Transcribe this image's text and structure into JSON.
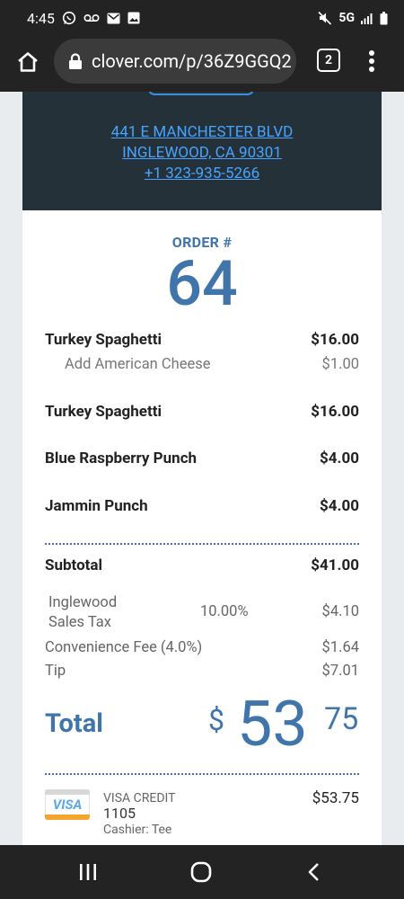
{
  "status_bar": {
    "time": "4:45",
    "network": "5G",
    "icons": [
      "whatsapp-icon",
      "voicemail-icon",
      "mail-icon",
      "image-icon",
      "mute-icon",
      "signal-icon",
      "battery-icon"
    ]
  },
  "browser": {
    "url": "clover.com/p/36Z9GGQ2",
    "tab_count": "2",
    "icons": [
      "home-icon",
      "lock-icon",
      "more-vert-icon"
    ]
  },
  "merchant": {
    "address_line1": "441 E MANCHESTER BLVD",
    "address_line2": "INGLEWOOD, CA 90301",
    "phone": "+1 323-935-5266"
  },
  "order": {
    "label": "ORDER #",
    "number": "64"
  },
  "items": [
    {
      "name": "Turkey Spaghetti",
      "price": "$16.00",
      "modifier": {
        "name": "Add American Cheese",
        "price": "$1.00"
      }
    },
    {
      "name": "Turkey Spaghetti",
      "price": "$16.00"
    },
    {
      "name": "Blue Raspberry Punch",
      "price": "$4.00"
    },
    {
      "name": "Jammin Punch",
      "price": "$4.00"
    }
  ],
  "subtotal": {
    "label": "Subtotal",
    "value": "$41.00"
  },
  "tax": {
    "name_line1": "Inglewood",
    "name_line2": "Sales Tax",
    "rate": "10.00%",
    "amount": "$4.10"
  },
  "fee": {
    "label": "Convenience Fee (4.0%)",
    "value": "$1.64"
  },
  "tip": {
    "label": "Tip",
    "value": "$7.01"
  },
  "total": {
    "label": "Total",
    "currency": "$",
    "dollars": "53",
    "cents": "75"
  },
  "payment": {
    "card_brand": "VISA",
    "card_type": "VISA CREDIT",
    "last4": "1105",
    "cashier": "Cashier: Tee",
    "amount": "$53.75"
  },
  "colors": {
    "brand_blue": "#3f75aa",
    "link_blue": "#47a3ff",
    "header_bg": "#253139",
    "system_bar": "#232323"
  },
  "nav": {
    "icons": [
      "recent-apps-icon",
      "home-circle-icon",
      "back-icon"
    ]
  }
}
